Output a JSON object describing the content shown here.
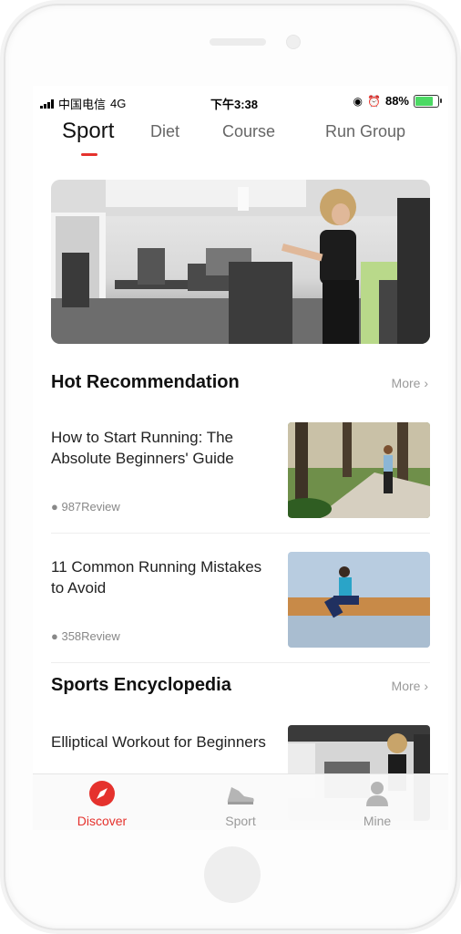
{
  "status_bar": {
    "carrier": "中国电信",
    "network": "4G",
    "time": "下午3:38",
    "battery_percent": "88%",
    "battery_level": 0.88
  },
  "top_tabs": [
    {
      "label": "Sport",
      "active": true
    },
    {
      "label": "Diet",
      "active": false
    },
    {
      "label": "Course",
      "active": false
    },
    {
      "label": "Run Group",
      "active": false
    }
  ],
  "hot_recommendation": {
    "title": "Hot Recommendation",
    "more": "More",
    "articles": [
      {
        "title": "How to Start Running: The Absolute Beginners' Guide",
        "reviews": "987Review"
      },
      {
        "title": "11 Common Running Mistakes to Avoid",
        "reviews": "358Review"
      }
    ]
  },
  "sports_encyclopedia": {
    "title": "Sports Encyclopedia",
    "more": "More",
    "articles": [
      {
        "title": "Elliptical Workout for Beginners"
      }
    ]
  },
  "tab_bar": [
    {
      "label": "Discover",
      "icon": "compass-icon",
      "active": true
    },
    {
      "label": "Sport",
      "icon": "sneaker-icon",
      "active": false
    },
    {
      "label": "Mine",
      "icon": "person-icon",
      "active": false
    }
  ],
  "colors": {
    "accent": "#e5322d",
    "inactive": "#9a9a9a"
  }
}
